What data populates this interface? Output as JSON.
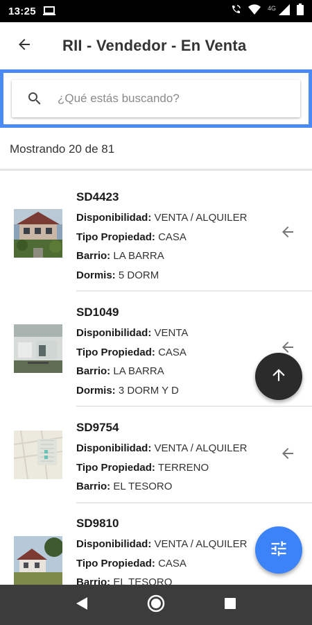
{
  "status_bar": {
    "time": "13:25",
    "network": "4G",
    "icons": [
      "laptop-icon",
      "wifi-calling-icon",
      "wifi-icon",
      "signal-icon",
      "battery-icon"
    ]
  },
  "app_bar": {
    "title": "RII - Vendedor - En Venta",
    "back_icon": "arrow-back-icon"
  },
  "search": {
    "placeholder": "¿Qué estás buscando?",
    "value": "",
    "icon": "search-icon",
    "focus_color": "#4a8af4"
  },
  "results": {
    "count_text": "Mostrando 20 de 81"
  },
  "listings": [
    {
      "code": "SD4423",
      "fields": [
        {
          "label": "Disponibilidad:",
          "value": "VENTA / ALQUILER"
        },
        {
          "label": "Tipo Propiedad:",
          "value": "CASA"
        },
        {
          "label": "Barrio:",
          "value": "LA BARRA"
        },
        {
          "label": "Dormis:",
          "value": "5 DORM"
        }
      ]
    },
    {
      "code": "SD1049",
      "fields": [
        {
          "label": "Disponibilidad:",
          "value": "VENTA"
        },
        {
          "label": "Tipo Propiedad:",
          "value": "CASA"
        },
        {
          "label": "Barrio:",
          "value": "LA BARRA"
        },
        {
          "label": "Dormis:",
          "value": "3 DORM Y D"
        }
      ]
    },
    {
      "code": "SD9754",
      "fields": [
        {
          "label": "Disponibilidad:",
          "value": "VENTA / ALQUILER"
        },
        {
          "label": "Tipo Propiedad:",
          "value": "TERRENO"
        },
        {
          "label": "Barrio:",
          "value": "EL TESORO"
        }
      ]
    },
    {
      "code": "SD9810",
      "fields": [
        {
          "label": "Disponibilidad:",
          "value": "VENTA / ALQUILER"
        },
        {
          "label": "Tipo Propiedad:",
          "value": "CASA"
        },
        {
          "label": "Barrio:",
          "value": "EL TESORO"
        }
      ]
    }
  ],
  "fabs": {
    "scroll_top_icon": "arrow-up-icon",
    "scroll_top_color": "#2b2b2b",
    "filter_icon": "tune-icon",
    "filter_color": "#3b83f6"
  },
  "nav_bar": {
    "icons": [
      "nav-back-icon",
      "nav-home-icon",
      "nav-recents-icon"
    ]
  }
}
